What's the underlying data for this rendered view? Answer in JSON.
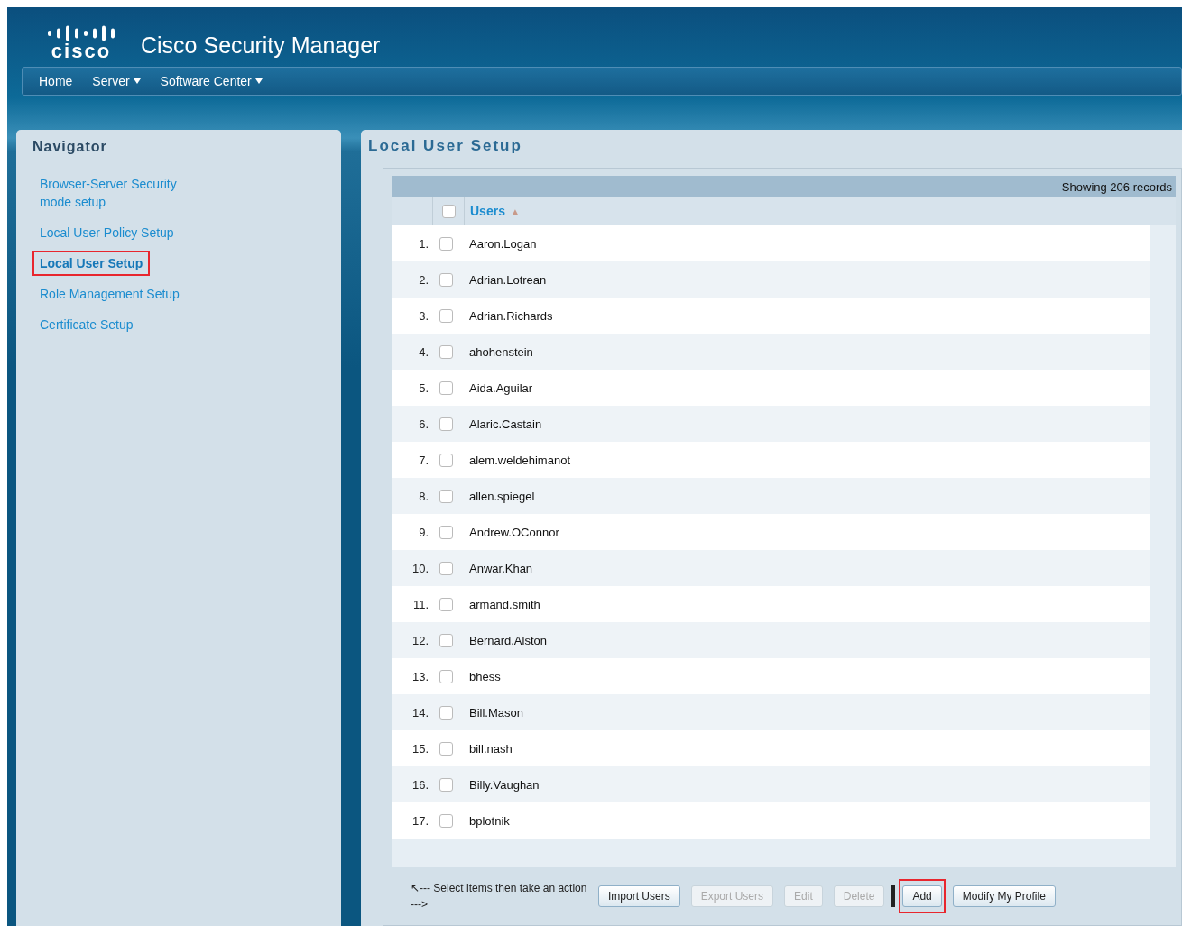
{
  "app": {
    "logo": "cisco",
    "title": "Cisco Security Manager"
  },
  "menu": [
    {
      "label": "Home",
      "dropdown": false
    },
    {
      "label": "Server",
      "dropdown": true
    },
    {
      "label": "Software Center",
      "dropdown": true
    }
  ],
  "navigator": {
    "title": "Navigator",
    "items": [
      {
        "label": "Browser-Server Security mode setup",
        "selected": false,
        "highlighted": false
      },
      {
        "label": "Local User Policy Setup",
        "selected": false,
        "highlighted": false
      },
      {
        "label": "Local User Setup",
        "selected": true,
        "highlighted": true
      },
      {
        "label": "Role Management Setup",
        "selected": false,
        "highlighted": false
      },
      {
        "label": "Certificate Setup",
        "selected": false,
        "highlighted": false
      }
    ]
  },
  "content": {
    "title": "Local User Setup",
    "record_count": "Showing 206 records",
    "column": "Users",
    "select_all_checked": false,
    "sort_indicator": "▲",
    "rows": [
      {
        "index": "1.",
        "name": "Aaron.Logan",
        "checked": false
      },
      {
        "index": "2.",
        "name": "Adrian.Lotrean",
        "checked": false
      },
      {
        "index": "3.",
        "name": "Adrian.Richards",
        "checked": false
      },
      {
        "index": "4.",
        "name": "ahohenstein",
        "checked": false
      },
      {
        "index": "5.",
        "name": "Aida.Aguilar",
        "checked": false
      },
      {
        "index": "6.",
        "name": "Alaric.Castain",
        "checked": false
      },
      {
        "index": "7.",
        "name": "alem.weldehimanot",
        "checked": false
      },
      {
        "index": "8.",
        "name": "allen.spiegel",
        "checked": false
      },
      {
        "index": "9.",
        "name": "Andrew.OConnor",
        "checked": false
      },
      {
        "index": "10.",
        "name": "Anwar.Khan",
        "checked": false
      },
      {
        "index": "11.",
        "name": "armand.smith",
        "checked": false
      },
      {
        "index": "12.",
        "name": "Bernard.Alston",
        "checked": false
      },
      {
        "index": "13.",
        "name": "bhess",
        "checked": false
      },
      {
        "index": "14.",
        "name": "Bill.Mason",
        "checked": false
      },
      {
        "index": "15.",
        "name": "bill.nash",
        "checked": false
      },
      {
        "index": "16.",
        "name": "Billy.Vaughan",
        "checked": false
      },
      {
        "index": "17.",
        "name": "bplotnik",
        "checked": false
      }
    ],
    "hint": "↖--- Select items then take an action --->",
    "buttons": [
      {
        "label": "Import Users",
        "disabled": false,
        "highlighted": false
      },
      {
        "label": "Export Users",
        "disabled": true,
        "highlighted": false
      },
      {
        "label": "Edit",
        "disabled": true,
        "highlighted": false
      },
      {
        "label": "Delete",
        "disabled": true,
        "highlighted": false
      },
      {
        "label": "Add",
        "disabled": false,
        "highlighted": true
      },
      {
        "label": "Modify My Profile",
        "disabled": false,
        "highlighted": false
      }
    ]
  }
}
